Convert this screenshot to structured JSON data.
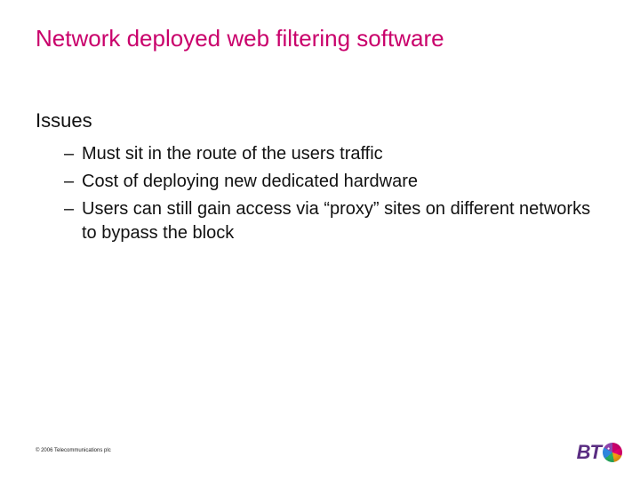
{
  "title": "Network deployed web filtering software",
  "subhead": "Issues",
  "bullets": [
    "Must sit in the route of the users traffic",
    "Cost of deploying new dedicated hardware",
    "Users can still gain access via “proxy” sites on different networks to bypass the block"
  ],
  "footer": "© 2006 Telecommunications plc",
  "logo_text": "BT"
}
